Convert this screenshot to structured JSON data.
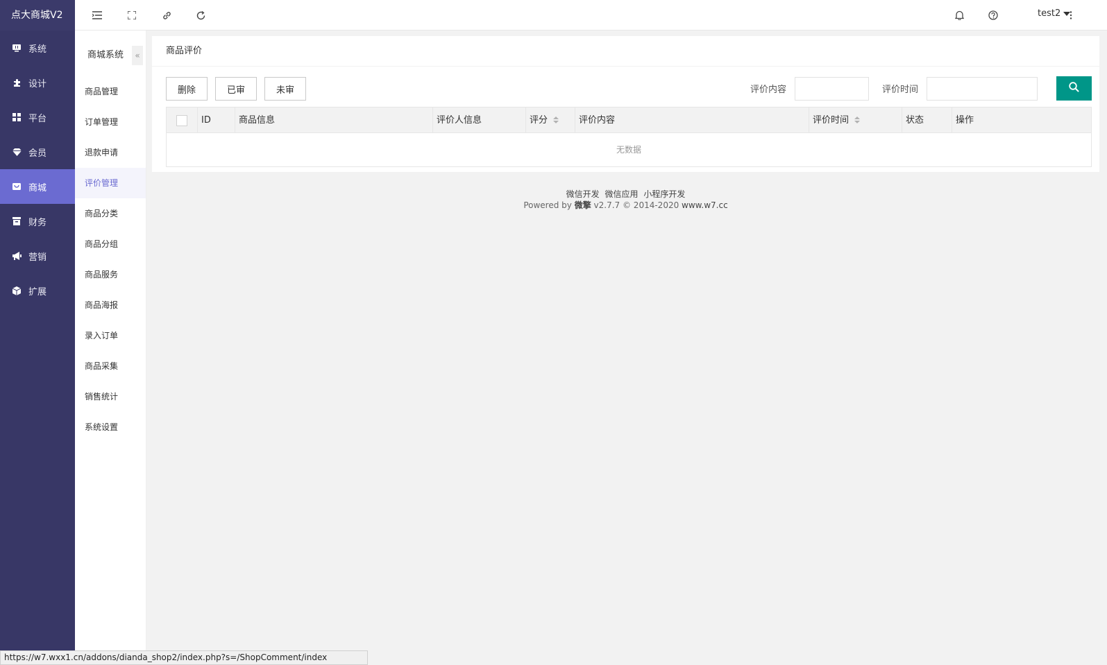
{
  "brand": "点大商城V2",
  "nav": [
    {
      "label": "系统",
      "icon": "monitor-icon"
    },
    {
      "label": "设计",
      "icon": "puzzle-icon"
    },
    {
      "label": "平台",
      "icon": "grid-icon"
    },
    {
      "label": "会员",
      "icon": "gem-icon"
    },
    {
      "label": "商城",
      "icon": "shop-icon",
      "active": true
    },
    {
      "label": "财务",
      "icon": "archive-icon"
    },
    {
      "label": "营销",
      "icon": "bullhorn-icon"
    },
    {
      "label": "扩展",
      "icon": "cube-icon"
    }
  ],
  "subnav": {
    "title": "商城系统",
    "collapse": "«",
    "items": [
      "商品管理",
      "订单管理",
      "退款申请",
      "评价管理",
      "商品分类",
      "商品分组",
      "商品服务",
      "商品海报",
      "录入订单",
      "商品采集",
      "销售统计",
      "系统设置"
    ],
    "active_index": 3
  },
  "topbar": {
    "user": "test2"
  },
  "page": {
    "title": "商品评价",
    "buttons": {
      "delete": "删除",
      "reviewed": "已审",
      "unreviewed": "未审"
    },
    "filters": {
      "content_label": "评价内容",
      "content_value": "",
      "time_label": "评价时间",
      "time_value": ""
    },
    "table": {
      "columns": [
        "ID",
        "商品信息",
        "评价人信息",
        "评分",
        "评价内容",
        "评价时间",
        "状态",
        "操作"
      ],
      "empty_text": "无数据"
    }
  },
  "footer": {
    "links": [
      "微信开发",
      "微信应用",
      "小程序开发"
    ],
    "powered_prefix": "Powered by",
    "powered_brand": "微擎",
    "powered_suffix": "v2.7.7 © 2014-2020",
    "site": "www.w7.cc"
  },
  "statusbar": "https://w7.wxx1.cn/addons/dianda_shop2/index.php?s=/ShopComment/index",
  "colors": {
    "sidebar": "#383766",
    "active_nav": "#6b6bd1",
    "search_button": "#009688"
  }
}
